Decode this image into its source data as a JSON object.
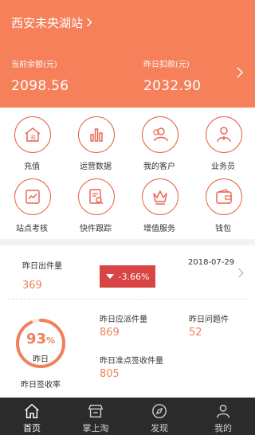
{
  "header": {
    "station_name": "西安未央湖站",
    "balance_label": "当前余额(元)",
    "balance_value": "2098.56",
    "deduction_label": "昨日扣款(元)",
    "deduction_value": "2032.90"
  },
  "menu": {
    "items": [
      {
        "label": "充值",
        "icon": "house-recharge-icon"
      },
      {
        "label": "运营数据",
        "icon": "bar-chart-icon"
      },
      {
        "label": "我的客户",
        "icon": "customers-icon"
      },
      {
        "label": "业务员",
        "icon": "salesman-icon"
      },
      {
        "label": "站点考核",
        "icon": "assessment-icon"
      },
      {
        "label": "快件跟踪",
        "icon": "tracking-icon"
      },
      {
        "label": "增值服务",
        "icon": "crown-icon"
      },
      {
        "label": "钱包",
        "icon": "wallet-icon"
      }
    ]
  },
  "stats": {
    "yesterday_out_label": "昨日出件量",
    "yesterday_out_value": "369",
    "change_badge": "-3.66%",
    "date": "2018-07-29",
    "sign_rate_value": "93",
    "sign_rate_unit": "%",
    "sign_rate_sub": "昨日",
    "sign_rate_label": "昨日签收率",
    "sign_rate_fraction": 0.93,
    "dispatch_label": "昨日应派件量",
    "dispatch_value": "869",
    "problem_label": "昨日问题件",
    "problem_value": "52",
    "ontime_label": "昨日准点签收件量",
    "ontime_value": "805"
  },
  "tabbar": {
    "tabs": [
      {
        "label": "首页",
        "icon": "home-icon",
        "active": true
      },
      {
        "label": "掌上淘",
        "icon": "shop-icon",
        "active": false
      },
      {
        "label": "发现",
        "icon": "compass-icon",
        "active": false
      },
      {
        "label": "我的",
        "icon": "profile-icon",
        "active": false
      }
    ]
  },
  "colors": {
    "header_bg": "#f5805a",
    "accent": "#f0805a",
    "badge_bg": "#d94444",
    "tabbar_bg": "#2b2b2b"
  }
}
